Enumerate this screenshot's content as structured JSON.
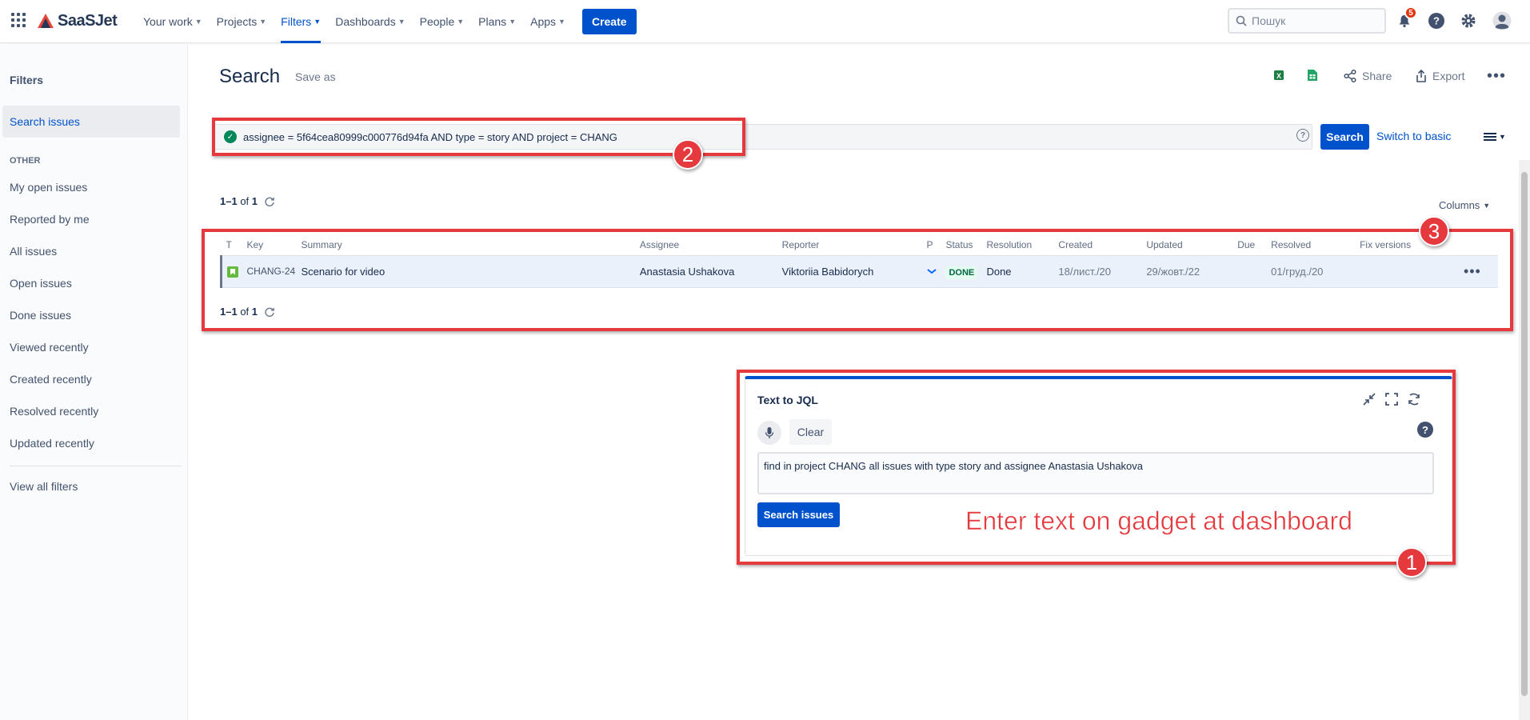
{
  "topnav": {
    "logo": "SaaSJet",
    "items": [
      {
        "label": "Your work"
      },
      {
        "label": "Projects"
      },
      {
        "label": "Filters"
      },
      {
        "label": "Dashboards"
      },
      {
        "label": "People"
      },
      {
        "label": "Plans"
      },
      {
        "label": "Apps"
      }
    ],
    "create_label": "Create",
    "search_placeholder": "Пошук",
    "notification_count": "5"
  },
  "sidebar": {
    "heading": "Filters",
    "search_issues": "Search issues",
    "other_label": "OTHER",
    "items": [
      "My open issues",
      "Reported by me",
      "All issues",
      "Open issues",
      "Done issues",
      "Viewed recently",
      "Created recently",
      "Resolved recently",
      "Updated recently"
    ],
    "view_all": "View all filters"
  },
  "main": {
    "title": "Search",
    "save_as": "Save as",
    "share": "Share",
    "export": "Export",
    "jql": "assignee = 5f64cea80999c000776d94fa AND type = story AND project = CHANG",
    "search_label": "Search",
    "switch_basic": "Switch to basic",
    "count_range": "1–1",
    "count_of": "of",
    "count_total": "1",
    "columns_label": "Columns"
  },
  "table": {
    "headers": [
      "T",
      "Key",
      "Summary",
      "Assignee",
      "Reporter",
      "P",
      "Status",
      "Resolution",
      "Created",
      "Updated",
      "Due",
      "Resolved",
      "Fix versions"
    ],
    "rows": [
      {
        "key": "CHANG-24",
        "summary": "Scenario for video",
        "assignee": "Anastasia Ushakova",
        "reporter": "Viktoriia Babidorych",
        "status": "DONE",
        "resolution": "Done",
        "created": "18/лист./20",
        "updated": "29/жовт./22",
        "due": "",
        "resolved": "01/груд./20",
        "fix_versions": ""
      }
    ]
  },
  "gadget": {
    "title": "Text to JQL",
    "clear_label": "Clear",
    "input_text": "find in project CHANG all issues with type story and assignee Anastasia Ushakova",
    "search_label": "Search issues"
  },
  "annotations": {
    "num1": "1",
    "num2": "2",
    "num3": "3",
    "caption": "Enter text on gadget at dashboard"
  },
  "colors": {
    "accent": "#0052cc",
    "annotation": "#e5393e",
    "done": "#006644",
    "story": "#63ba3c"
  }
}
